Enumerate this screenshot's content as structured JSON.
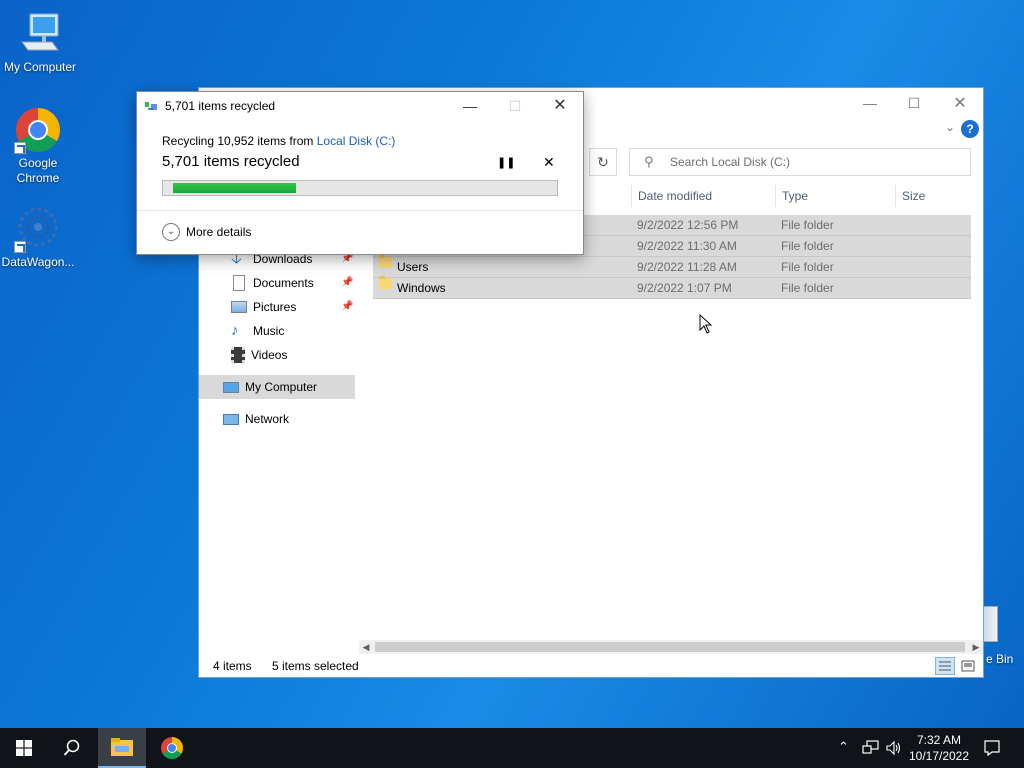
{
  "desktop": {
    "icons": [
      {
        "label": "My Computer"
      },
      {
        "label": "Google\nChrome"
      },
      {
        "label": "DataWagon..."
      }
    ],
    "recycle_bin_partial_label": "e Bin"
  },
  "explorer": {
    "search_placeholder": "Search Local Disk (C:)",
    "nav": {
      "downloads": "Downloads",
      "documents": "Documents",
      "pictures": "Pictures",
      "music": "Music",
      "videos": "Videos",
      "my_computer": "My Computer",
      "network": "Network"
    },
    "columns": {
      "date_modified": "Date modified",
      "type": "Type",
      "size": "Size"
    },
    "rows": [
      {
        "name": "",
        "date": "9/2/2022 12:56 PM",
        "type": "File folder"
      },
      {
        "name": "",
        "date": "9/2/2022 11:30 AM",
        "type": "File folder"
      },
      {
        "name": "Users",
        "date": "9/2/2022 11:28 AM",
        "type": "File folder"
      },
      {
        "name": "Windows",
        "date": "9/2/2022 1:07 PM",
        "type": "File folder"
      }
    ],
    "status": {
      "item_count": "4 items",
      "selected": "5 items selected"
    }
  },
  "dialog": {
    "title": "5,701 items recycled",
    "recycling_prefix": "Recycling 10,952 items from ",
    "source_link": "Local Disk (C:)",
    "heading": "5,701 items recycled",
    "progress": 0.33,
    "more_details": "More details"
  },
  "taskbar": {
    "time": "7:32 AM",
    "date": "10/17/2022"
  },
  "colors": {
    "desktop": "#0b78d6",
    "progress_fill": "#2bbf45",
    "taskbar": "#101318",
    "link": "#1a5fb4"
  }
}
